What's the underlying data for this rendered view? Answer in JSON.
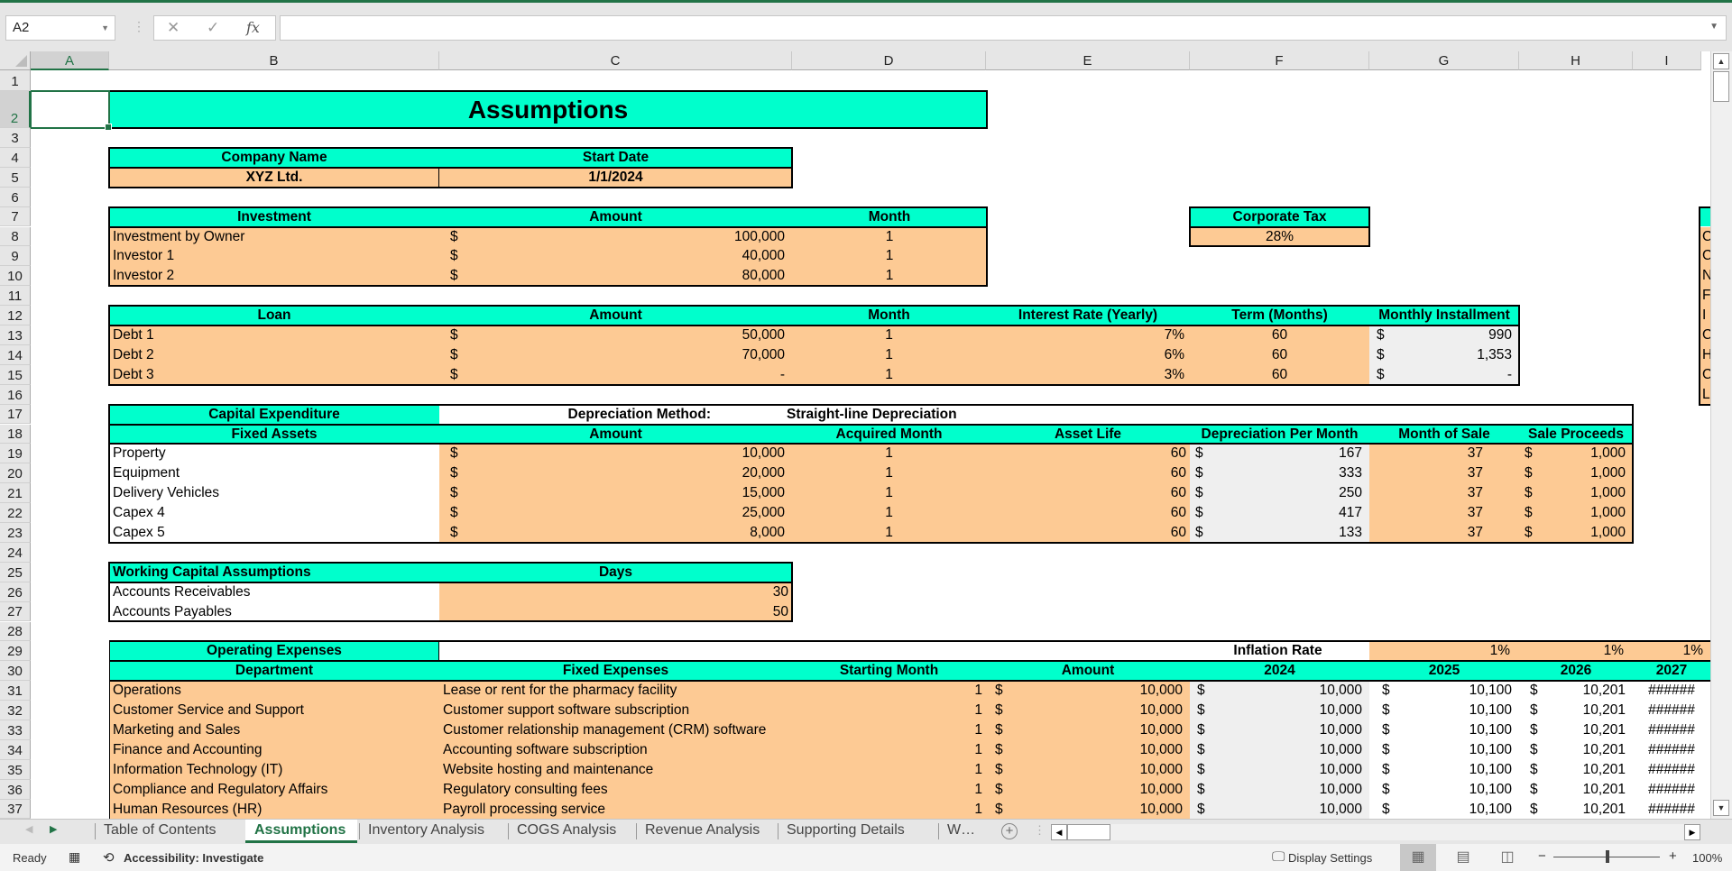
{
  "app": {
    "accent": "#217346"
  },
  "formula_bar": {
    "name_box": "A2",
    "cancel_icon": "✕",
    "enter_icon": "✓",
    "fx_label": "fx",
    "formula": ""
  },
  "columns": [
    "A",
    "B",
    "C",
    "D",
    "E",
    "F",
    "G",
    "H",
    "I"
  ],
  "rows": [
    "1",
    "2",
    "3",
    "4",
    "5",
    "6",
    "7",
    "8",
    "9",
    "10",
    "11",
    "12",
    "13",
    "14",
    "15",
    "16",
    "17",
    "18",
    "19",
    "20",
    "21",
    "22",
    "23",
    "24",
    "25",
    "26",
    "27",
    "28",
    "29",
    "30",
    "31",
    "32",
    "33",
    "34",
    "35",
    "36",
    "37"
  ],
  "sheet": {
    "title": "Assumptions",
    "company": {
      "header_name": "Company Name",
      "header_date": "Start Date",
      "name": "XYZ Ltd.",
      "start_date": "1/1/2024"
    },
    "investment": {
      "headers": [
        "Investment",
        "Amount",
        "Month"
      ],
      "rows": [
        {
          "label": "Investment by Owner",
          "cur": "$",
          "amount": "100,000",
          "month": "1"
        },
        {
          "label": "Investor 1",
          "cur": "$",
          "amount": "40,000",
          "month": "1"
        },
        {
          "label": "Investor 2",
          "cur": "$",
          "amount": "80,000",
          "month": "1"
        }
      ]
    },
    "tax": {
      "header": "Corporate Tax",
      "value": "28%"
    },
    "loan": {
      "headers": [
        "Loan",
        "Amount",
        "Month",
        "Interest Rate (Yearly)",
        "Term (Months)",
        "Monthly Installment"
      ],
      "rows": [
        {
          "label": "Debt 1",
          "cur": "$",
          "amount": "50,000",
          "month": "1",
          "rate": "7%",
          "term": "60",
          "cur2": "$",
          "installment": "990"
        },
        {
          "label": "Debt 2",
          "cur": "$",
          "amount": "70,000",
          "month": "1",
          "rate": "6%",
          "term": "60",
          "cur2": "$",
          "installment": "1,353"
        },
        {
          "label": "Debt 3",
          "cur": "$",
          "amount": "-",
          "month": "1",
          "rate": "3%",
          "term": "60",
          "cur2": "$",
          "installment": "-"
        }
      ]
    },
    "capex": {
      "title": "Capital Expenditure",
      "method_label": "Depreciation Method:",
      "method_value": "Straight-line Depreciation",
      "headers": [
        "Fixed Assets",
        "Amount",
        "Acquired Month",
        "Asset Life",
        "Depreciation Per Month",
        "Month of Sale",
        "Sale Proceeds"
      ],
      "rows": [
        {
          "label": "Property",
          "cur": "$",
          "amount": "10,000",
          "month": "1",
          "life": "60",
          "cur2": "$",
          "dep": "167",
          "sale_month": "37",
          "cur3": "$",
          "proceeds": "1,000"
        },
        {
          "label": "Equipment",
          "cur": "$",
          "amount": "20,000",
          "month": "1",
          "life": "60",
          "cur2": "$",
          "dep": "333",
          "sale_month": "37",
          "cur3": "$",
          "proceeds": "1,000"
        },
        {
          "label": "Delivery Vehicles",
          "cur": "$",
          "amount": "15,000",
          "month": "1",
          "life": "60",
          "cur2": "$",
          "dep": "250",
          "sale_month": "37",
          "cur3": "$",
          "proceeds": "1,000"
        },
        {
          "label": "Capex 4",
          "cur": "$",
          "amount": "25,000",
          "month": "1",
          "life": "60",
          "cur2": "$",
          "dep": "417",
          "sale_month": "37",
          "cur3": "$",
          "proceeds": "1,000"
        },
        {
          "label": "Capex 5",
          "cur": "$",
          "amount": "8,000",
          "month": "1",
          "life": "60",
          "cur2": "$",
          "dep": "133",
          "sale_month": "37",
          "cur3": "$",
          "proceeds": "1,000"
        }
      ]
    },
    "working_capital": {
      "headers": [
        "Working Capital Assumptions",
        "Days"
      ],
      "rows": [
        {
          "label": "Accounts Receivables",
          "days": "30"
        },
        {
          "label": "Accounts Payables",
          "days": "50"
        }
      ]
    },
    "opex": {
      "title": "Operating Expenses",
      "inflation_label": "Inflation Rate",
      "inflation": [
        "1%",
        "1%",
        "1%"
      ],
      "headers": [
        "Department",
        "Fixed Expenses",
        "Starting Month",
        "Amount",
        "2024",
        "2025",
        "2026",
        "2027"
      ],
      "rows": [
        {
          "dept": "Operations",
          "expense": "Lease or rent for the pharmacy facility",
          "start": "1",
          "amount": "10,000",
          "y2024": "10,000",
          "y2025": "10,100",
          "y2026": "10,201",
          "y2027": "######"
        },
        {
          "dept": "Customer Service and Support",
          "expense": "Customer support software subscription",
          "start": "1",
          "amount": "10,000",
          "y2024": "10,000",
          "y2025": "10,100",
          "y2026": "10,201",
          "y2027": "######"
        },
        {
          "dept": "Marketing and Sales",
          "expense": "Customer relationship management (CRM) software",
          "start": "1",
          "amount": "10,000",
          "y2024": "10,000",
          "y2025": "10,100",
          "y2026": "10,201",
          "y2027": "######"
        },
        {
          "dept": "Finance and Accounting",
          "expense": "Accounting software subscription",
          "start": "1",
          "amount": "10,000",
          "y2024": "10,000",
          "y2025": "10,100",
          "y2026": "10,201",
          "y2027": "######"
        },
        {
          "dept": "Information Technology (IT)",
          "expense": "Website hosting and maintenance",
          "start": "1",
          "amount": "10,000",
          "y2024": "10,000",
          "y2025": "10,100",
          "y2026": "10,201",
          "y2027": "######"
        },
        {
          "dept": "Compliance and Regulatory Affairs",
          "expense": "Regulatory consulting fees",
          "start": "1",
          "amount": "10,000",
          "y2024": "10,000",
          "y2025": "10,100",
          "y2026": "10,201",
          "y2027": "######"
        },
        {
          "dept": "Human Resources (HR)",
          "expense": "Payroll processing service",
          "start": "1",
          "amount": "10,000",
          "y2024": "10,000",
          "y2025": "10,100",
          "y2026": "10,201",
          "y2027": "######"
        }
      ],
      "cur": "$"
    },
    "side_partial": [
      "C",
      "C",
      "N",
      "F",
      "I",
      "C",
      "H",
      "C",
      "L"
    ]
  },
  "tabs": [
    "Table of Contents",
    "Assumptions",
    "Inventory Analysis",
    "COGS Analysis",
    "Revenue Analysis",
    "Supporting Details",
    "W…"
  ],
  "active_tab": 1,
  "status": {
    "ready": "Ready",
    "accessibility": "Accessibility: Investigate",
    "display_settings": "Display Settings",
    "zoom": "100%",
    "zoom_minus": "−",
    "zoom_plus": "+"
  }
}
